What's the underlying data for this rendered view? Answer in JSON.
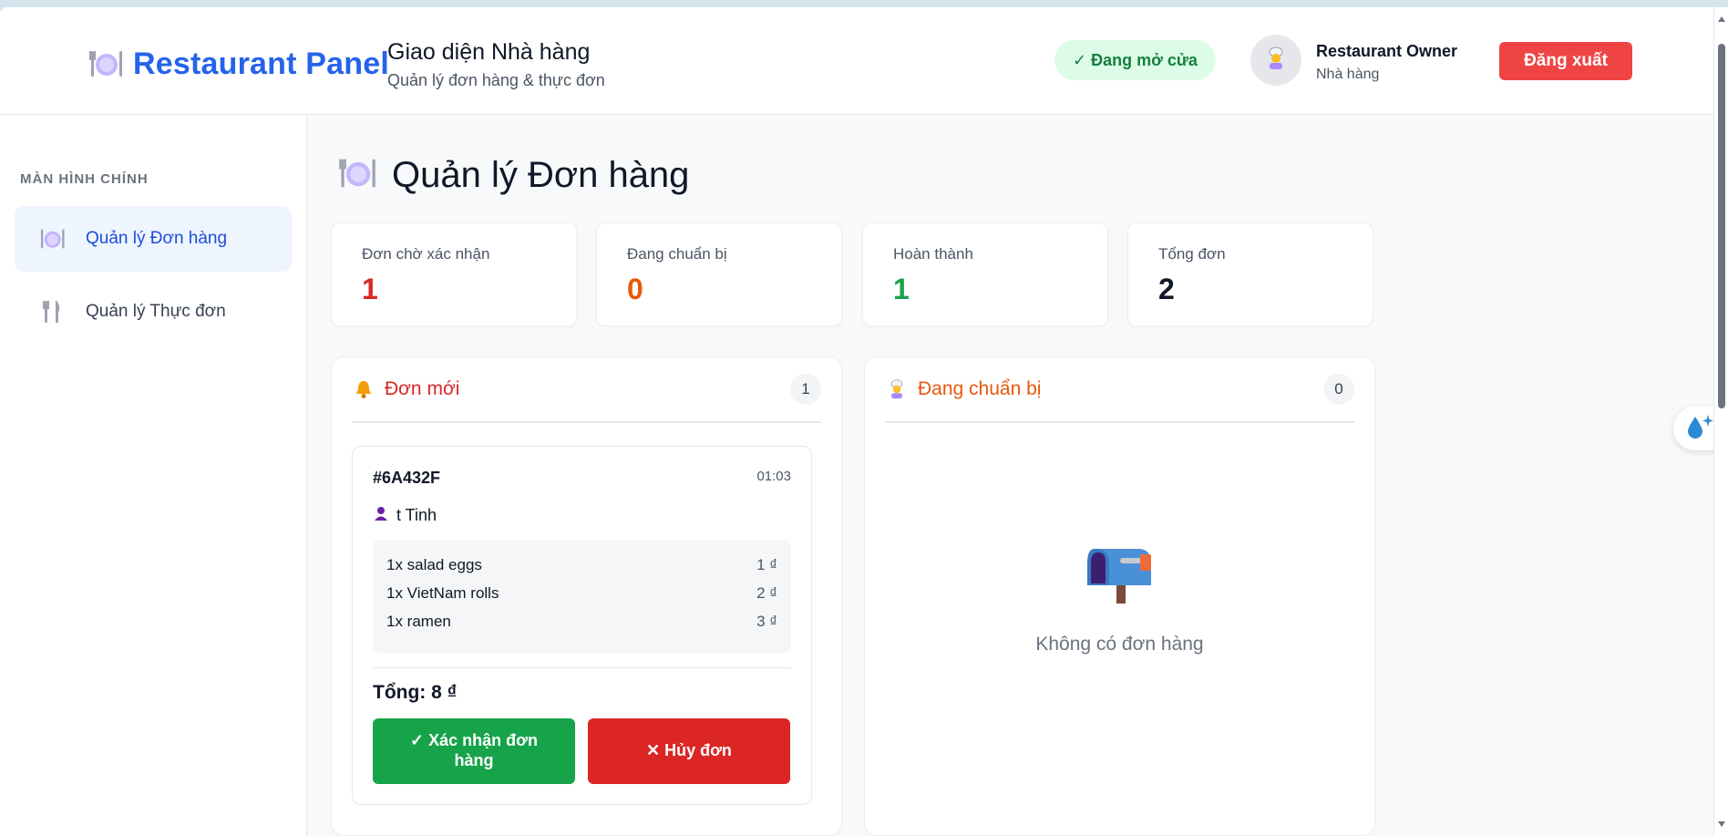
{
  "header": {
    "brand": "Restaurant Panel",
    "title": "Giao diện Nhà hàng",
    "subtitle": "Quản lý đơn hàng & thực đơn",
    "status": "✓ Đang mở cửa",
    "user_name": "Restaurant Owner",
    "user_role": "Nhà hàng",
    "logout_label": "Đăng xuất"
  },
  "sidebar": {
    "section_label": "MÀN HÌNH CHÍNH",
    "items": [
      {
        "label": "Quản lý Đơn hàng",
        "icon": "plate-icon",
        "active": true
      },
      {
        "label": "Quản lý Thực đơn",
        "icon": "fork-knife-icon",
        "active": false
      }
    ]
  },
  "main": {
    "page_title": "Quản lý Đơn hàng",
    "stats": [
      {
        "label": "Đơn chờ xác nhận",
        "value": "1",
        "color": "#dc2626"
      },
      {
        "label": "Đang chuẩn bị",
        "value": "0",
        "color": "#ea580c"
      },
      {
        "label": "Hoàn thành",
        "value": "1",
        "color": "#16a34a"
      },
      {
        "label": "Tổng đơn",
        "value": "2",
        "color": "#111827"
      }
    ],
    "new_orders": {
      "title": "Đơn mới",
      "count": "1",
      "title_color": "#dc2626",
      "order": {
        "id": "#6A432F",
        "time": "01:03",
        "customer": "t Tinh",
        "items": [
          {
            "name": "1x salad eggs",
            "price": "1 ₫"
          },
          {
            "name": "1x VietNam rolls",
            "price": "2 ₫"
          },
          {
            "name": "1x ramen",
            "price": "3 ₫"
          }
        ],
        "total": "Tổng: 8 ₫",
        "confirm_label": "✓ Xác nhận đơn hàng",
        "cancel_label": "✕ Hủy đơn"
      }
    },
    "preparing": {
      "title": "Đang chuẩn bị",
      "count": "0",
      "title_color": "#ea580c",
      "empty_text": "Không có đơn hàng"
    }
  }
}
